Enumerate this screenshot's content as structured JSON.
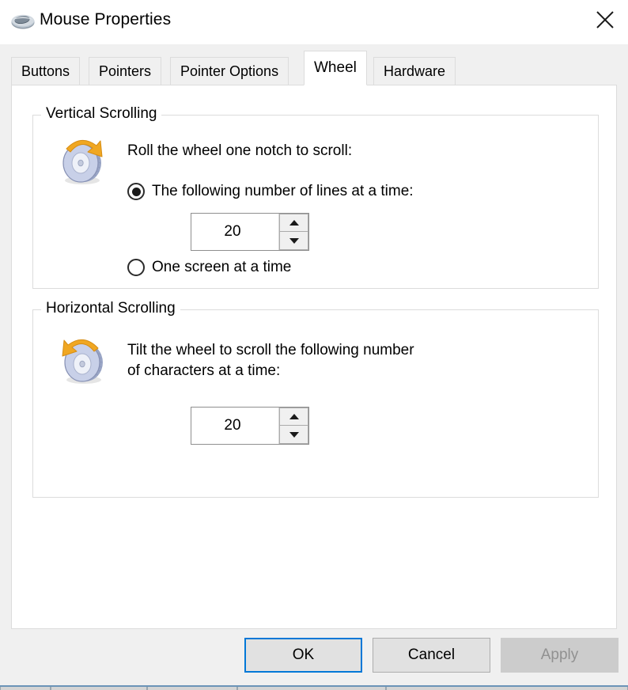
{
  "window": {
    "title": "Mouse Properties",
    "icon": "mouse-icon",
    "close_label": "✕"
  },
  "tabs": [
    {
      "label": "Buttons",
      "active": false
    },
    {
      "label": "Pointers",
      "active": false
    },
    {
      "label": "Pointer Options",
      "active": false
    },
    {
      "label": "Wheel",
      "active": true
    },
    {
      "label": "Hardware",
      "active": false
    }
  ],
  "vertical_scrolling": {
    "legend": "Vertical Scrolling",
    "icon": "scroll-wheel-vertical-icon",
    "instruction": "Roll the wheel one notch to scroll:",
    "options": [
      {
        "label": "The following number of lines at a time:",
        "selected": true
      },
      {
        "label": "One screen at a time",
        "selected": false
      }
    ],
    "lines_spinner": {
      "value": "20",
      "increment_label": "increase",
      "decrement_label": "decrease"
    }
  },
  "horizontal_scrolling": {
    "legend": "Horizontal Scrolling",
    "icon": "scroll-wheel-horizontal-icon",
    "instruction": "Tilt the wheel to scroll the following number\nof characters at a time:",
    "chars_spinner": {
      "value": "20",
      "increment_label": "increase",
      "decrement_label": "decrease"
    }
  },
  "footer": {
    "ok_label": "OK",
    "cancel_label": "Cancel",
    "apply_label": "Apply",
    "apply_enabled": false
  },
  "colors": {
    "accent": "#0078d7",
    "dialog_bg": "#f0f0f0",
    "panel_bg": "#ffffff",
    "border": "#dcdcdc",
    "disabled_text": "#919191",
    "wheel_body": "#c2cbe3",
    "wheel_arrow": "#f0a722"
  }
}
